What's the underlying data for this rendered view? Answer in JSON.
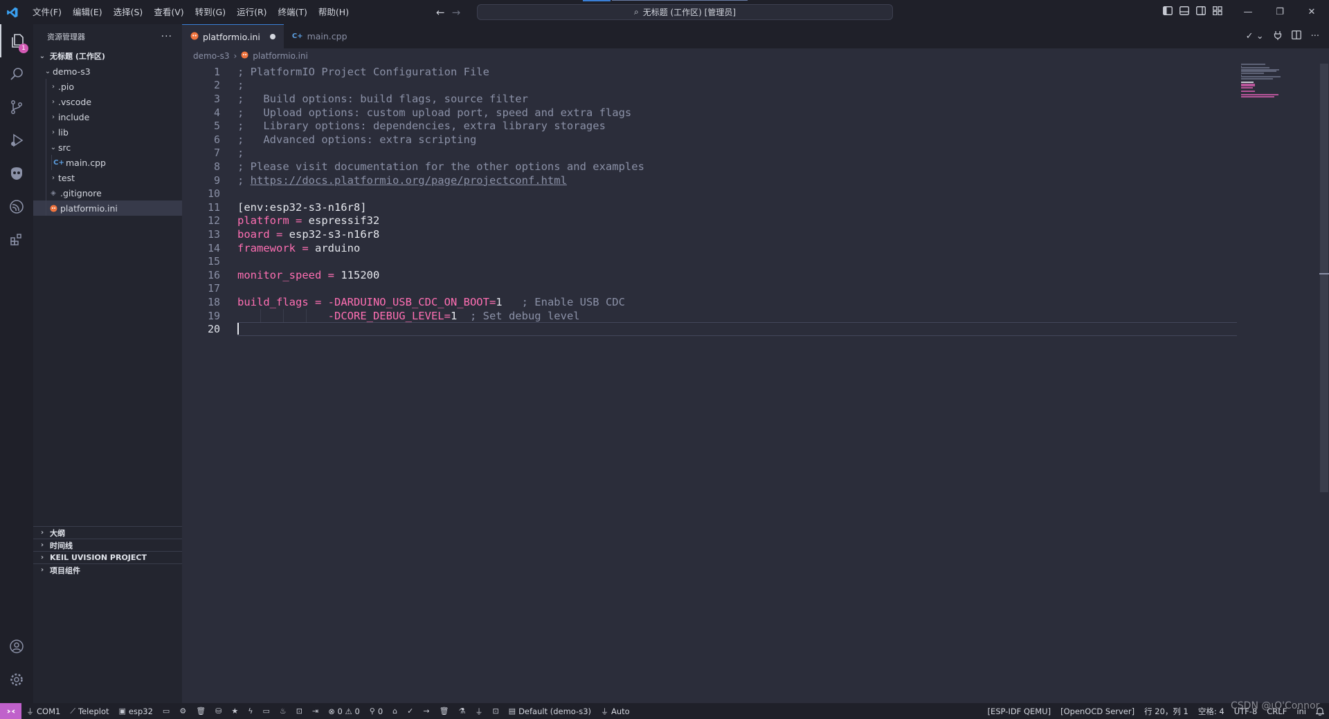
{
  "titlebar": {
    "menu": [
      "文件(F)",
      "编辑(E)",
      "选择(S)",
      "查看(V)",
      "转到(G)",
      "运行(R)",
      "终端(T)",
      "帮助(H)"
    ],
    "command_center": "无标题 (工作区) [管理员]"
  },
  "activity": {
    "explorer_badge": "1"
  },
  "sidebar": {
    "title": "资源管理器",
    "more": "···",
    "workspace": "无标题 (工作区)",
    "tree": [
      {
        "label": "demo-s3",
        "depth": 1,
        "kind": "folder-open"
      },
      {
        "label": ".pio",
        "depth": 2,
        "kind": "folder"
      },
      {
        "label": ".vscode",
        "depth": 2,
        "kind": "folder"
      },
      {
        "label": "include",
        "depth": 2,
        "kind": "folder"
      },
      {
        "label": "lib",
        "depth": 2,
        "kind": "folder"
      },
      {
        "label": "src",
        "depth": 2,
        "kind": "folder-open"
      },
      {
        "label": "main.cpp",
        "depth": 3,
        "kind": "cpp"
      },
      {
        "label": "test",
        "depth": 2,
        "kind": "folder"
      },
      {
        "label": ".gitignore",
        "depth": 2,
        "kind": "git"
      },
      {
        "label": "platformio.ini",
        "depth": 2,
        "kind": "pio",
        "selected": true
      }
    ],
    "sections": [
      "大纲",
      "时间线",
      "KEIL UVISION PROJECT",
      "项目组件"
    ]
  },
  "tabs": [
    {
      "label": "platformio.ini",
      "active": true,
      "dirty": true
    },
    {
      "label": "main.cpp",
      "active": false,
      "dirty": false
    }
  ],
  "breadcrumb": {
    "folder": "demo-s3",
    "file": "platformio.ini"
  },
  "editor": {
    "current_line": 20,
    "lines": [
      {
        "n": "1",
        "parts": [
          {
            "t": "; PlatformIO Project Configuration File",
            "c": "comment"
          }
        ]
      },
      {
        "n": "2",
        "parts": [
          {
            "t": ";",
            "c": "comment"
          }
        ]
      },
      {
        "n": "3",
        "parts": [
          {
            "t": ";   Build options: build flags, source filter",
            "c": "comment"
          }
        ]
      },
      {
        "n": "4",
        "parts": [
          {
            "t": ";   Upload options: custom upload port, speed and extra flags",
            "c": "comment"
          }
        ]
      },
      {
        "n": "5",
        "parts": [
          {
            "t": ";   Library options: dependencies, extra library storages",
            "c": "comment"
          }
        ]
      },
      {
        "n": "6",
        "parts": [
          {
            "t": ";   Advanced options: extra scripting",
            "c": "comment"
          }
        ]
      },
      {
        "n": "7",
        "parts": [
          {
            "t": ";",
            "c": "comment"
          }
        ]
      },
      {
        "n": "8",
        "parts": [
          {
            "t": "; Please visit documentation for the other options and examples",
            "c": "comment"
          }
        ]
      },
      {
        "n": "9",
        "parts": [
          {
            "t": "; ",
            "c": "comment"
          },
          {
            "t": "https://docs.platformio.org/page/projectconf.html",
            "c": "link"
          }
        ]
      },
      {
        "n": "10",
        "parts": []
      },
      {
        "n": "11",
        "parts": [
          {
            "t": "[env:esp32-s3-n16r8]",
            "c": "section"
          }
        ]
      },
      {
        "n": "12",
        "parts": [
          {
            "t": "platform",
            "c": "key"
          },
          {
            "t": " = ",
            "c": "op"
          },
          {
            "t": "espressif32",
            "c": "val"
          }
        ]
      },
      {
        "n": "13",
        "parts": [
          {
            "t": "board",
            "c": "key"
          },
          {
            "t": " = ",
            "c": "op"
          },
          {
            "t": "esp32-s3-n16r8",
            "c": "val"
          }
        ]
      },
      {
        "n": "14",
        "parts": [
          {
            "t": "framework",
            "c": "key"
          },
          {
            "t": " = ",
            "c": "op"
          },
          {
            "t": "arduino",
            "c": "val"
          }
        ]
      },
      {
        "n": "15",
        "parts": []
      },
      {
        "n": "16",
        "parts": [
          {
            "t": "monitor_speed",
            "c": "key"
          },
          {
            "t": " = ",
            "c": "op"
          },
          {
            "t": "115200",
            "c": "val"
          }
        ]
      },
      {
        "n": "17",
        "parts": []
      },
      {
        "n": "18",
        "parts": [
          {
            "t": "build_flags",
            "c": "key"
          },
          {
            "t": " = ",
            "c": "op"
          },
          {
            "t": "-DARDUINO_USB_CDC_ON_BOOT=",
            "c": "flag"
          },
          {
            "t": "1",
            "c": "val"
          },
          {
            "t": "   ; Enable USB CDC",
            "c": "comment"
          }
        ]
      },
      {
        "n": "19",
        "parts": [
          {
            "t": "              ",
            "c": "val"
          },
          {
            "t": "-DCORE_DEBUG_LEVEL=",
            "c": "flag"
          },
          {
            "t": "1",
            "c": "val"
          },
          {
            "t": "  ; Set debug level",
            "c": "comment"
          }
        ]
      },
      {
        "n": "20",
        "parts": []
      }
    ]
  },
  "statusbar": {
    "left": [
      {
        "icon": "plug-icon",
        "label": "COM1"
      },
      {
        "icon": "chart-icon",
        "label": "Teleplot"
      },
      {
        "icon": "chip-icon",
        "label": "esp32"
      },
      {
        "icon": "folder-icon",
        "label": ""
      },
      {
        "icon": "gear-icon",
        "label": ""
      },
      {
        "icon": "trash-icon",
        "label": ""
      },
      {
        "icon": "database-icon",
        "label": ""
      },
      {
        "icon": "star-icon",
        "label": ""
      },
      {
        "icon": "flash-icon",
        "label": ""
      },
      {
        "icon": "monitor-icon",
        "label": ""
      },
      {
        "icon": "flame-icon",
        "label": ""
      },
      {
        "icon": "terminal-icon",
        "label": ""
      },
      {
        "icon": "upload-icon",
        "label": ""
      },
      {
        "icon": "problems-icon",
        "label": "⊗ 0 ⚠ 0"
      },
      {
        "icon": "ports-icon",
        "label": "0"
      },
      {
        "icon": "home-icon",
        "label": ""
      },
      {
        "icon": "check-icon",
        "label": ""
      },
      {
        "icon": "arrow-right-icon",
        "label": ""
      },
      {
        "icon": "trash-icon",
        "label": ""
      },
      {
        "icon": "flask-icon",
        "label": ""
      },
      {
        "icon": "plug-icon",
        "label": ""
      },
      {
        "icon": "terminal-icon",
        "label": ""
      },
      {
        "icon": "env-icon",
        "label": "Default (demo-s3)"
      },
      {
        "icon": "plug-icon",
        "label": "Auto"
      }
    ],
    "right": [
      "[ESP-IDF QEMU]",
      "[OpenOCD Server]",
      "行 20，列 1",
      "空格: 4",
      "UTF-8",
      "CRLF",
      "ini"
    ],
    "watermark": "CSDN @ιQ'Connor"
  },
  "colors": {
    "accent": "#3a7fd6",
    "keyword": "#ff6fb3",
    "comment": "#8b91a7",
    "remote": "#c061cb"
  }
}
